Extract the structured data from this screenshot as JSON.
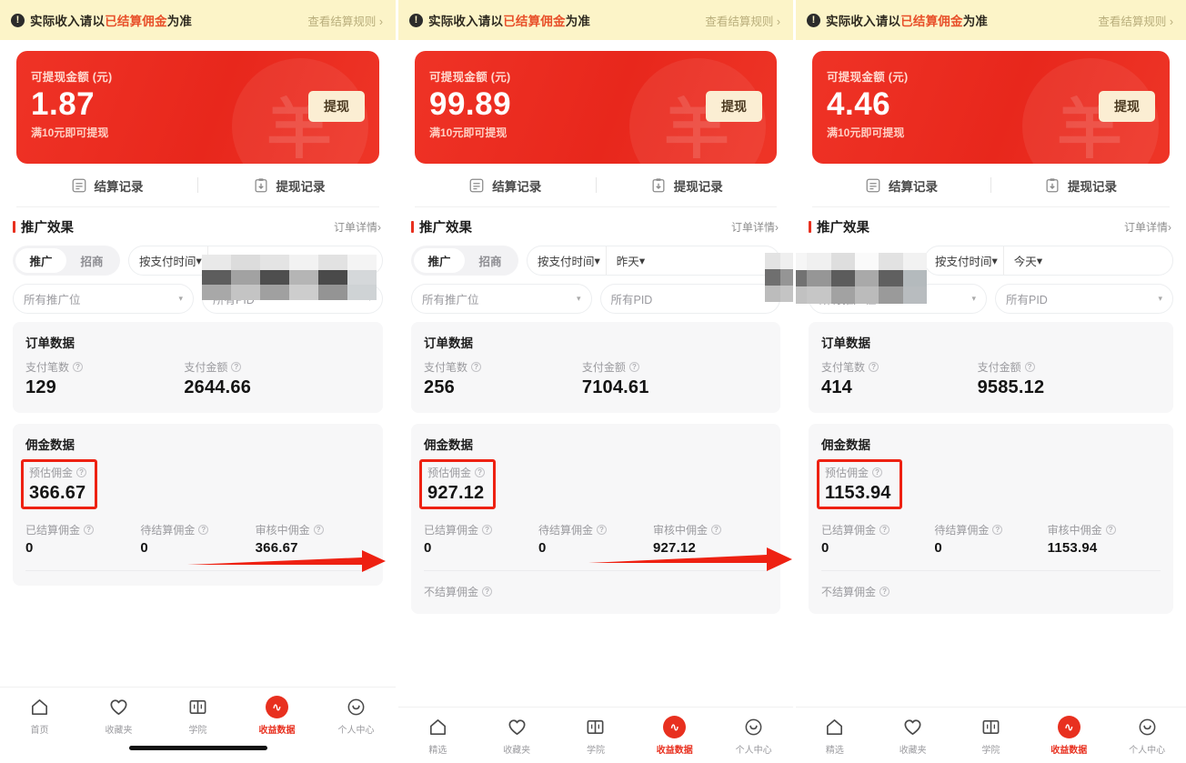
{
  "meta": {
    "accent_red": "#e8301f",
    "card_red": "#ee2f23",
    "banner_yellow": "#fcf4c8",
    "button_cream": "#fbeed3",
    "highlight_box_red": "#ee2112"
  },
  "notice": {
    "icon": "exclamation-circle-icon",
    "text_before": "实际收入请以",
    "text_highlight": "已结算佣金",
    "text_after": "为准",
    "link": "查看结算规则",
    "chevron": "›"
  },
  "balance_card": {
    "label": "可提现金额 (元)",
    "sub": "满10元即可提现",
    "withdraw_button": "提现",
    "watermark": "羊"
  },
  "records": {
    "settlement": {
      "label": "结算记录",
      "icon": "list-document-icon"
    },
    "withdraw": {
      "label": "提现记录",
      "icon": "clipboard-download-icon"
    }
  },
  "promo_section": {
    "title": "推广效果",
    "link": "订单详情",
    "chevron": "›"
  },
  "filters": {
    "segment": {
      "active": "推广",
      "inactive": "招商"
    },
    "time_mode": "按支付时间",
    "slot": "所有推广位",
    "pid": "所有PID",
    "caret": "▾"
  },
  "order_card": {
    "title": "订单数据",
    "metrics": [
      {
        "label": "支付笔数",
        "help": "?"
      },
      {
        "label": "支付金额",
        "help": "?"
      }
    ]
  },
  "commission_card": {
    "title": "佣金数据",
    "estimated_label": "预估佣金",
    "help": "?",
    "sub_metrics": [
      {
        "label": "已结算佣金"
      },
      {
        "label": "待结算佣金"
      },
      {
        "label": "审核中佣金"
      }
    ],
    "unsettled_label": "不结算佣金"
  },
  "panels": [
    {
      "id": "panel-1",
      "balance": "1.87",
      "date_range": "",
      "date_censored": true,
      "order": {
        "pay_count": "129",
        "pay_amount": "2644.66"
      },
      "commission": {
        "estimated": "366.67",
        "settled": "0",
        "pending": "0",
        "reviewing": "366.67"
      },
      "show_unsettled_row": false,
      "show_home_indicator": true,
      "nav": [
        {
          "label": "首页",
          "icon": "home-icon",
          "active": false
        },
        {
          "label": "收藏夹",
          "icon": "heart-icon",
          "active": false
        },
        {
          "label": "学院",
          "icon": "book-icon",
          "active": false
        },
        {
          "label": "收益数据",
          "icon": "earnings-badge-icon",
          "active": true
        },
        {
          "label": "个人中心",
          "icon": "smiley-face-icon",
          "active": false
        }
      ]
    },
    {
      "id": "panel-2",
      "balance": "99.89",
      "date_range": "昨天",
      "date_censored": false,
      "order": {
        "pay_count": "256",
        "pay_amount": "7104.61"
      },
      "commission": {
        "estimated": "927.12",
        "settled": "0",
        "pending": "0",
        "reviewing": "927.12"
      },
      "show_unsettled_row": true,
      "show_home_indicator": false,
      "nav": [
        {
          "label": "精选",
          "icon": "home-icon",
          "active": false
        },
        {
          "label": "收藏夹",
          "icon": "heart-icon",
          "active": false
        },
        {
          "label": "学院",
          "icon": "book-icon",
          "active": false
        },
        {
          "label": "收益数据",
          "icon": "earnings-badge-icon",
          "active": true
        },
        {
          "label": "个人中心",
          "icon": "smiley-face-icon",
          "active": false
        }
      ]
    },
    {
      "id": "panel-3",
      "balance": "4.46",
      "date_range": "今天",
      "date_censored": false,
      "segment_censored": true,
      "order": {
        "pay_count": "414",
        "pay_amount": "9585.12"
      },
      "commission": {
        "estimated": "1153.94",
        "settled": "0",
        "pending": "0",
        "reviewing": "1153.94"
      },
      "show_unsettled_row": true,
      "show_home_indicator": false,
      "nav": [
        {
          "label": "精选",
          "icon": "home-icon",
          "active": false
        },
        {
          "label": "收藏夹",
          "icon": "heart-icon",
          "active": false
        },
        {
          "label": "学院",
          "icon": "book-icon",
          "active": false
        },
        {
          "label": "收益数据",
          "icon": "earnings-badge-icon",
          "active": true
        },
        {
          "label": "个人中心",
          "icon": "smiley-face-icon",
          "active": false
        }
      ]
    }
  ],
  "annotations": {
    "arrows": [
      {
        "from_panel": 1,
        "to_panel": 2,
        "color": "#ee2112"
      },
      {
        "from_panel": 2,
        "to_panel": 3,
        "color": "#ee2112"
      }
    ]
  }
}
